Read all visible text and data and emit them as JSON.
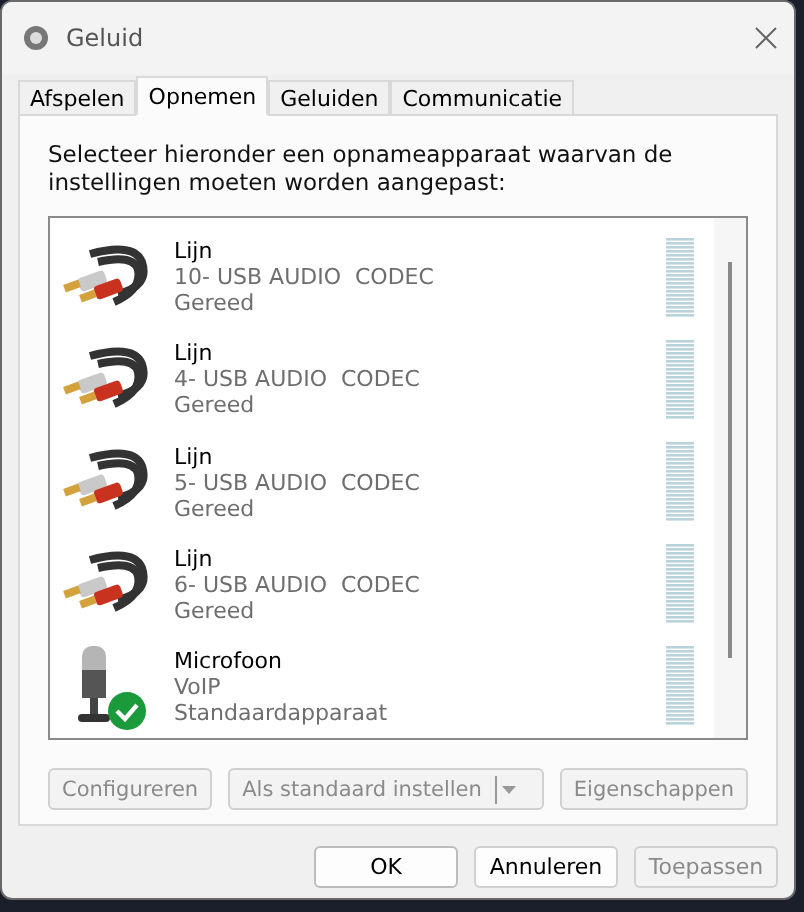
{
  "window": {
    "title": "Geluid"
  },
  "tabs": [
    {
      "label": "Afspelen",
      "selected": false
    },
    {
      "label": "Opnemen",
      "selected": true
    },
    {
      "label": "Geluiden",
      "selected": false
    },
    {
      "label": "Communicatie",
      "selected": false
    }
  ],
  "instruction": "Selecteer hieronder een opnameapparaat waarvan de instellingen moeten worden aangepast:",
  "devices": [
    {
      "kind": "cable",
      "name": "Lijn",
      "description": "10- USB AUDIO  CODEC",
      "status": "Gereed",
      "default": false
    },
    {
      "kind": "cable",
      "name": "Lijn",
      "description": "4- USB AUDIO  CODEC",
      "status": "Gereed",
      "default": false
    },
    {
      "kind": "cable",
      "name": "Lijn",
      "description": "5- USB AUDIO  CODEC",
      "status": "Gereed",
      "default": false
    },
    {
      "kind": "cable",
      "name": "Lijn",
      "description": "6- USB AUDIO  CODEC",
      "status": "Gereed",
      "default": false
    },
    {
      "kind": "microphone",
      "name": "Microfoon",
      "description": "VoIP",
      "status": "Standaardapparaat",
      "default": true
    }
  ],
  "device_buttons": [
    {
      "kind": "plain",
      "label": "Configureren",
      "disabled": true
    },
    {
      "kind": "split",
      "label": "Als standaard instellen",
      "disabled": true
    },
    {
      "kind": "plain",
      "label": "Eigenschappen",
      "disabled": true
    }
  ],
  "dialog_buttons": [
    {
      "label": "OK",
      "disabled": false,
      "primary": true
    },
    {
      "label": "Annuleren",
      "disabled": false,
      "primary": false
    },
    {
      "label": "Toepassen",
      "disabled": true,
      "primary": false
    }
  ]
}
